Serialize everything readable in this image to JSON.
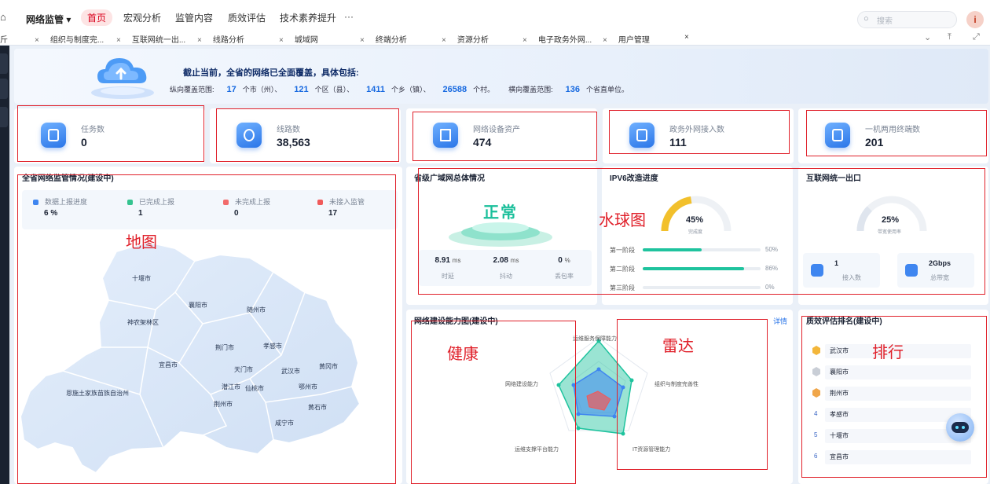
{
  "topbar": {
    "brand": "网络监管 ▾",
    "menu": [
      "首页",
      "宏观分析",
      "监管内容",
      "质效评估",
      "技术素养提升",
      "···"
    ],
    "search_placeholder": "搜索",
    "avatar_initial": "i"
  },
  "tabs": [
    "组织与制度完...",
    "互联网统一出...",
    "线路分析",
    "城域网",
    "终端分析",
    "资源分析",
    "电子政务外网...",
    "用户管理"
  ],
  "banner": {
    "title": "截止当前，全省的网络已全面覆盖，具体包括:",
    "vertical_label": "纵向覆盖范围:",
    "cities": "17",
    "cities_unit": "个市（州）、",
    "districts": "121",
    "districts_unit": "个区（县）、",
    "towns": "1411",
    "towns_unit": "个乡（镇）、",
    "villages": "26588",
    "villages_unit": "个村。",
    "horizontal_label": "横向覆盖范围:",
    "units": "136",
    "units_unit": "个省直单位。"
  },
  "stats": [
    {
      "label": "任务数",
      "value": "0"
    },
    {
      "label": "线路数",
      "value": "38,563"
    },
    {
      "label": "网络设备资产",
      "value": "474"
    },
    {
      "label": "政务外网接入数",
      "value": "111"
    },
    {
      "label": "一机两用终端数",
      "value": "201"
    }
  ],
  "map_panel": {
    "title": "全省网络监管情况(建设中)",
    "annotation": "地图",
    "items": [
      {
        "label": "数据上报进度",
        "value": "6 %",
        "color": "#3f86f0"
      },
      {
        "label": "已完成上报",
        "value": "1",
        "color": "#34c38f"
      },
      {
        "label": "未完成上报",
        "value": "0",
        "color": "#f26b6b"
      },
      {
        "label": "未接入监管",
        "value": "17",
        "color": "#f05a5a"
      }
    ],
    "cities": [
      "十堰市",
      "襄阳市",
      "随州市",
      "神农架林区",
      "荆门市",
      "孝感市",
      "宜昌市",
      "天门市",
      "武汉市",
      "黄冈市",
      "恩施土家族苗族自治州",
      "潜江市",
      "仙桃市",
      "鄂州市",
      "荆州市",
      "黄石市",
      "咸宁市"
    ]
  },
  "wan_panel": {
    "title": "省级广域网总体情况",
    "status": "正常",
    "latency": "8.91",
    "latency_unit": "ms",
    "latency_label": "时延",
    "jitter": "2.08",
    "jitter_unit": "ms",
    "jitter_label": "抖动",
    "loss": "0",
    "loss_unit": "%",
    "loss_label": "丢包率"
  },
  "ipv6_panel": {
    "title": "IPV6改造进度",
    "annotation": "水球图",
    "percent": "45%",
    "percent_value": 0.45,
    "percent_label": "完成度",
    "stages": [
      {
        "label": "第一阶段",
        "pct": "50%",
        "value": 0.5
      },
      {
        "label": "第二阶段",
        "pct": "86%",
        "value": 0.86
      },
      {
        "label": "第三阶段",
        "pct": "0%",
        "value": 0
      }
    ]
  },
  "internet_panel": {
    "title": "互联网统一出口",
    "percent": "25%",
    "percent_value": 0.25,
    "percent_label": "带宽使用率",
    "access_value": "1",
    "access_label": "接入数",
    "bandwidth_value": "2Gbps",
    "bandwidth_label": "总带宽"
  },
  "radar_panel": {
    "title": "网络建设能力图(建设中)",
    "more": "详情",
    "annotation_left": "健康",
    "annotation_right": "雷达",
    "axes": [
      "运维服务保障能力",
      "组织与制度完善性",
      "IT资源管理能力",
      "运维支撑平台能力",
      "网络建设能力"
    ]
  },
  "rank_panel": {
    "title": "质效评估排名(建设中)",
    "annotation": "排行",
    "items": [
      {
        "rank": "1",
        "name": "武汉市",
        "color": "#f3b63a"
      },
      {
        "rank": "2",
        "name": "襄阳市",
        "color": "#c9ced6"
      },
      {
        "rank": "3",
        "name": "荆州市",
        "color": "#f0a64a"
      },
      {
        "rank": "4",
        "name": "孝感市",
        "color": ""
      },
      {
        "rank": "5",
        "name": "十堰市",
        "color": ""
      },
      {
        "rank": "6",
        "name": "宜昌市",
        "color": ""
      }
    ]
  }
}
